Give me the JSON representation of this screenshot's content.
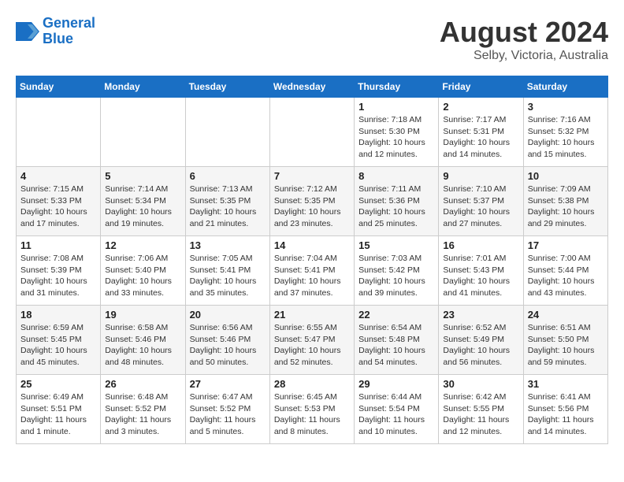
{
  "header": {
    "logo_line1": "General",
    "logo_line2": "Blue",
    "month_title": "August 2024",
    "location": "Selby, Victoria, Australia"
  },
  "weekdays": [
    "Sunday",
    "Monday",
    "Tuesday",
    "Wednesday",
    "Thursday",
    "Friday",
    "Saturday"
  ],
  "weeks": [
    [
      {
        "day": "",
        "info": ""
      },
      {
        "day": "",
        "info": ""
      },
      {
        "day": "",
        "info": ""
      },
      {
        "day": "",
        "info": ""
      },
      {
        "day": "1",
        "sunrise": "7:18 AM",
        "sunset": "5:30 PM",
        "daylight": "10 hours and 12 minutes."
      },
      {
        "day": "2",
        "sunrise": "7:17 AM",
        "sunset": "5:31 PM",
        "daylight": "10 hours and 14 minutes."
      },
      {
        "day": "3",
        "sunrise": "7:16 AM",
        "sunset": "5:32 PM",
        "daylight": "10 hours and 15 minutes."
      }
    ],
    [
      {
        "day": "4",
        "sunrise": "7:15 AM",
        "sunset": "5:33 PM",
        "daylight": "10 hours and 17 minutes."
      },
      {
        "day": "5",
        "sunrise": "7:14 AM",
        "sunset": "5:34 PM",
        "daylight": "10 hours and 19 minutes."
      },
      {
        "day": "6",
        "sunrise": "7:13 AM",
        "sunset": "5:35 PM",
        "daylight": "10 hours and 21 minutes."
      },
      {
        "day": "7",
        "sunrise": "7:12 AM",
        "sunset": "5:35 PM",
        "daylight": "10 hours and 23 minutes."
      },
      {
        "day": "8",
        "sunrise": "7:11 AM",
        "sunset": "5:36 PM",
        "daylight": "10 hours and 25 minutes."
      },
      {
        "day": "9",
        "sunrise": "7:10 AM",
        "sunset": "5:37 PM",
        "daylight": "10 hours and 27 minutes."
      },
      {
        "day": "10",
        "sunrise": "7:09 AM",
        "sunset": "5:38 PM",
        "daylight": "10 hours and 29 minutes."
      }
    ],
    [
      {
        "day": "11",
        "sunrise": "7:08 AM",
        "sunset": "5:39 PM",
        "daylight": "10 hours and 31 minutes."
      },
      {
        "day": "12",
        "sunrise": "7:06 AM",
        "sunset": "5:40 PM",
        "daylight": "10 hours and 33 minutes."
      },
      {
        "day": "13",
        "sunrise": "7:05 AM",
        "sunset": "5:41 PM",
        "daylight": "10 hours and 35 minutes."
      },
      {
        "day": "14",
        "sunrise": "7:04 AM",
        "sunset": "5:41 PM",
        "daylight": "10 hours and 37 minutes."
      },
      {
        "day": "15",
        "sunrise": "7:03 AM",
        "sunset": "5:42 PM",
        "daylight": "10 hours and 39 minutes."
      },
      {
        "day": "16",
        "sunrise": "7:01 AM",
        "sunset": "5:43 PM",
        "daylight": "10 hours and 41 minutes."
      },
      {
        "day": "17",
        "sunrise": "7:00 AM",
        "sunset": "5:44 PM",
        "daylight": "10 hours and 43 minutes."
      }
    ],
    [
      {
        "day": "18",
        "sunrise": "6:59 AM",
        "sunset": "5:45 PM",
        "daylight": "10 hours and 45 minutes."
      },
      {
        "day": "19",
        "sunrise": "6:58 AM",
        "sunset": "5:46 PM",
        "daylight": "10 hours and 48 minutes."
      },
      {
        "day": "20",
        "sunrise": "6:56 AM",
        "sunset": "5:46 PM",
        "daylight": "10 hours and 50 minutes."
      },
      {
        "day": "21",
        "sunrise": "6:55 AM",
        "sunset": "5:47 PM",
        "daylight": "10 hours and 52 minutes."
      },
      {
        "day": "22",
        "sunrise": "6:54 AM",
        "sunset": "5:48 PM",
        "daylight": "10 hours and 54 minutes."
      },
      {
        "day": "23",
        "sunrise": "6:52 AM",
        "sunset": "5:49 PM",
        "daylight": "10 hours and 56 minutes."
      },
      {
        "day": "24",
        "sunrise": "6:51 AM",
        "sunset": "5:50 PM",
        "daylight": "10 hours and 59 minutes."
      }
    ],
    [
      {
        "day": "25",
        "sunrise": "6:49 AM",
        "sunset": "5:51 PM",
        "daylight": "11 hours and 1 minute."
      },
      {
        "day": "26",
        "sunrise": "6:48 AM",
        "sunset": "5:52 PM",
        "daylight": "11 hours and 3 minutes."
      },
      {
        "day": "27",
        "sunrise": "6:47 AM",
        "sunset": "5:52 PM",
        "daylight": "11 hours and 5 minutes."
      },
      {
        "day": "28",
        "sunrise": "6:45 AM",
        "sunset": "5:53 PM",
        "daylight": "11 hours and 8 minutes."
      },
      {
        "day": "29",
        "sunrise": "6:44 AM",
        "sunset": "5:54 PM",
        "daylight": "11 hours and 10 minutes."
      },
      {
        "day": "30",
        "sunrise": "6:42 AM",
        "sunset": "5:55 PM",
        "daylight": "11 hours and 12 minutes."
      },
      {
        "day": "31",
        "sunrise": "6:41 AM",
        "sunset": "5:56 PM",
        "daylight": "11 hours and 14 minutes."
      }
    ]
  ]
}
